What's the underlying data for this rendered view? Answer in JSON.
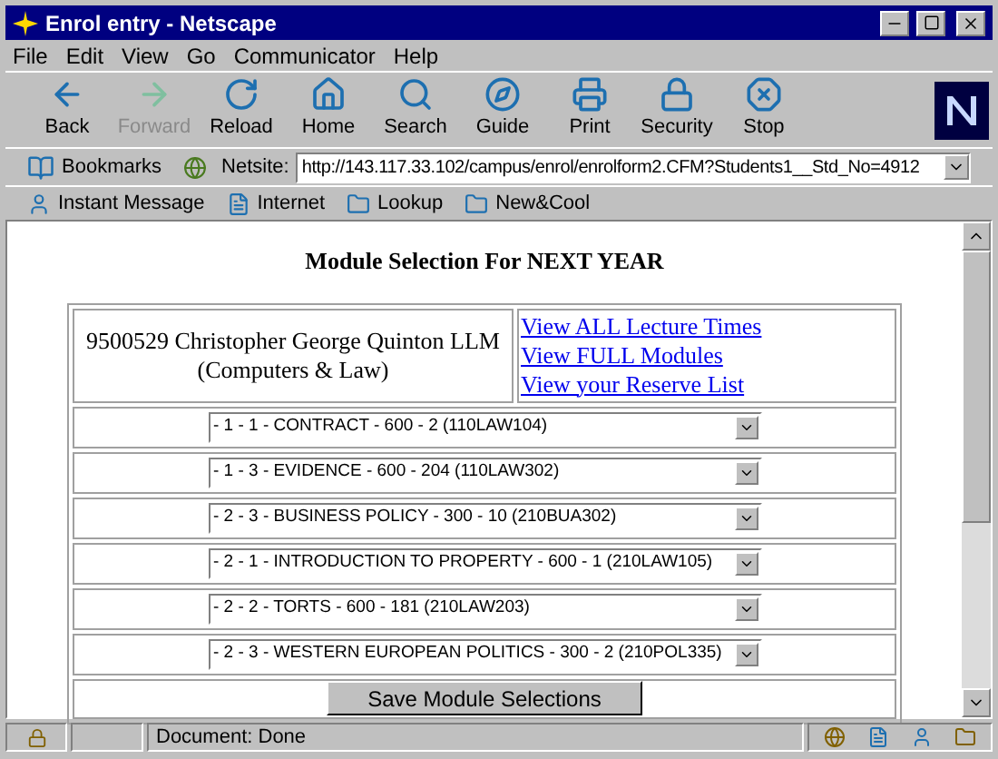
{
  "window": {
    "title": "Enrol entry - Netscape"
  },
  "menu": [
    "File",
    "Edit",
    "View",
    "Go",
    "Communicator",
    "Help"
  ],
  "toolbar": [
    {
      "label": "Back",
      "disabled": false
    },
    {
      "label": "Forward",
      "disabled": true
    },
    {
      "label": "Reload",
      "disabled": false
    },
    {
      "label": "Home",
      "disabled": false
    },
    {
      "label": "Search",
      "disabled": false
    },
    {
      "label": "Guide",
      "disabled": false
    },
    {
      "label": "Print",
      "disabled": false
    },
    {
      "label": "Security",
      "disabled": false
    },
    {
      "label": "Stop",
      "disabled": false
    }
  ],
  "location": {
    "bookmarks": "Bookmarks",
    "netsite_label": "Netsite:",
    "url": "http://143.117.33.102/campus/enrol/enrolform2.CFM?Students1__Std_No=4912"
  },
  "personal_bar": [
    "Instant Message",
    "Internet",
    "Lookup",
    "New&Cool"
  ],
  "page": {
    "heading": "Module Selection For NEXT YEAR",
    "student": [
      "9500529 Christopher George Quinton LLM",
      "(Computers & Law)"
    ],
    "links": [
      "View ALL Lecture Times",
      "View FULL Modules",
      "View your Reserve List"
    ],
    "modules": [
      "- 1 - 1 - CONTRACT - 600 - 2 (110LAW104)",
      "- 1 - 3 - EVIDENCE - 600 - 204 (110LAW302)",
      "- 2 - 3 - BUSINESS POLICY - 300 - 10 (210BUA302)",
      "- 2 - 1 - INTRODUCTION TO PROPERTY - 600 - 1 (210LAW105)",
      "- 2 - 2 - TORTS - 600 - 181 (210LAW203)",
      "- 2 - 3 - WESTERN EUROPEAN POLITICS - 300 - 2 (210POL335)"
    ],
    "save_button": "Save Module Selections"
  },
  "status_bar": {
    "text": "Document: Done"
  }
}
